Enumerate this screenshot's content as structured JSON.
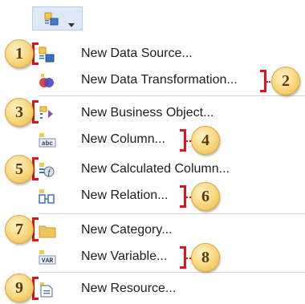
{
  "toolbar": {
    "button_icon": "new-items-icon",
    "caret_icon": "chevron-down-icon"
  },
  "menu": {
    "items": [
      {
        "label": "New Data Source...",
        "icon": "data-source-icon",
        "callout": "1"
      },
      {
        "label": "New Data Transformation...",
        "icon": "data-transformation-icon",
        "callout": "2"
      },
      {
        "label": "New Business Object...",
        "icon": "business-object-icon",
        "callout": "3"
      },
      {
        "label": "New Column...",
        "icon": "column-abc-icon",
        "callout": "4"
      },
      {
        "label": "New Calculated Column...",
        "icon": "calculated-column-icon",
        "callout": "5"
      },
      {
        "label": "New Relation...",
        "icon": "relation-icon",
        "callout": "6"
      },
      {
        "label": "New Category...",
        "icon": "category-folder-icon",
        "callout": "7"
      },
      {
        "label": "New Variable...",
        "icon": "variable-icon",
        "callout": "8"
      },
      {
        "label": "New Resource...",
        "icon": "resource-icon",
        "callout": "9"
      }
    ]
  },
  "colors": {
    "accent_red": "#e1141e",
    "callout_fill": "#f7d67a",
    "menu_separator": "#d4d4d4",
    "toolbar_bg": "#dde9f7"
  }
}
